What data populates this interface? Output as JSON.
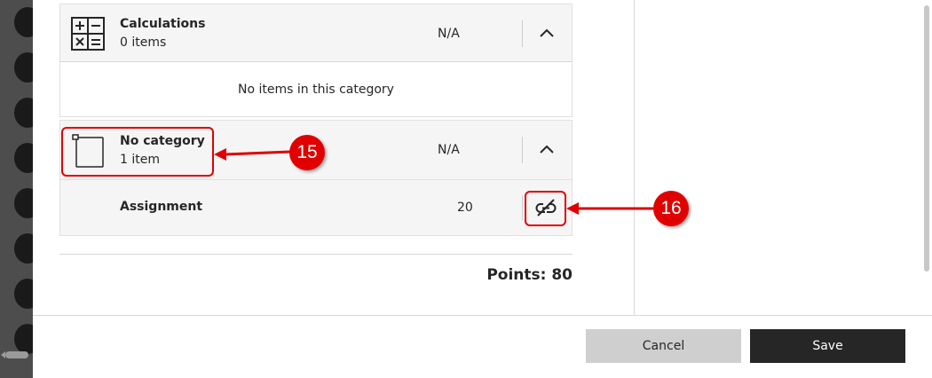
{
  "categories": [
    {
      "name": "Calculations",
      "count": "0 items",
      "points": "N/A",
      "empty_message": "No items in this category",
      "icon": "calculator-icon"
    },
    {
      "name": "No category",
      "count": "1 item",
      "points": "N/A",
      "icon": "document-icon",
      "items": [
        {
          "name": "Assignment",
          "points": "20",
          "action_icon": "unlink-icon"
        }
      ]
    }
  ],
  "total_points": "Points: 80",
  "footer": {
    "cancel_label": "Cancel",
    "save_label": "Save"
  },
  "annotations": [
    {
      "number": "15",
      "color": "#e00000"
    },
    {
      "number": "16",
      "color": "#e00000"
    }
  ]
}
